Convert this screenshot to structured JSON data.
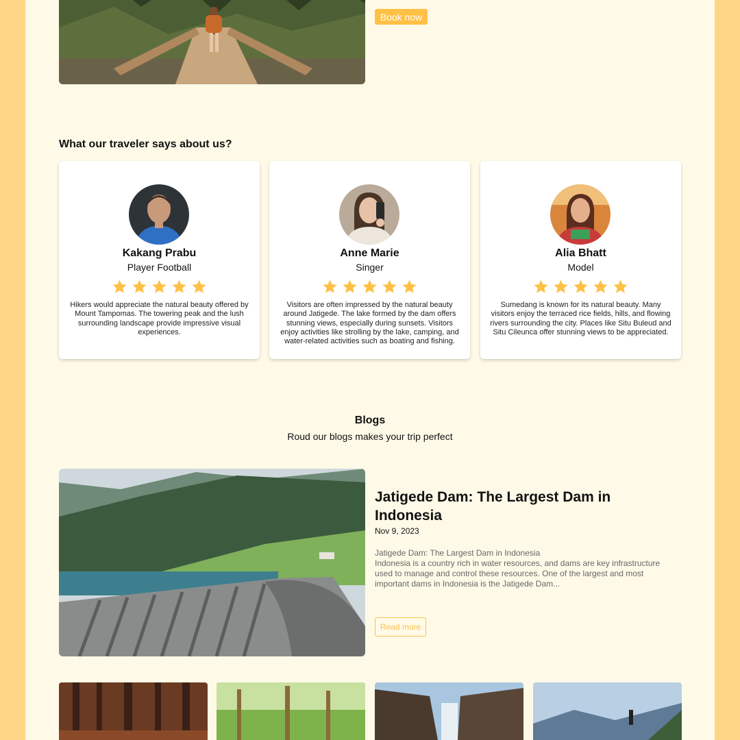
{
  "hero": {
    "book_label": "Book now"
  },
  "testimonials": {
    "title": "What our traveler says about us?",
    "items": [
      {
        "name": "Kakang Prabu",
        "role": "Player Football",
        "rating": 5,
        "text": "Hikers would appreciate the natural beauty offered by Mount Tampomas. The towering peak and the lush surrounding landscape provide impressive visual experiences."
      },
      {
        "name": "Anne Marie",
        "role": "Singer",
        "rating": 5,
        "text": "Visitors are often impressed by the natural beauty around Jatigede. The lake formed by the dam offers stunning views, especially during sunsets. Visitors enjoy activities like strolling by the lake, camping, and water-related activities such as boating and fishing."
      },
      {
        "name": "Alia Bhatt",
        "role": "Model",
        "rating": 5,
        "text": "Sumedang is known for its natural beauty. Many visitors enjoy the terraced rice fields, hills, and flowing rivers surrounding the city. Places like Situ Buleud and Situ Cileunca offer stunning views to be appreciated."
      }
    ]
  },
  "blogs": {
    "title": "Blogs",
    "subtitle": "Roud our blogs makes your trip perfect",
    "featured": {
      "title": "Jatigede Dam: The Largest Dam in Indonesia",
      "date": "Nov 9, 2023",
      "excerpt_heading": "Jatigede Dam: The Largest Dam in Indonesia",
      "excerpt": "Indonesia is a country rich in water resources, and dams are key infrastructure used to manage and control these resources. One of the largest and most important dams in Indonesia is the Jatigede Dam...",
      "read_more_label": "Read more"
    }
  },
  "colors": {
    "accent": "#fec045",
    "page_bg": "#fffae8",
    "outer_bg": "#ffd688",
    "card_bg": "#ffffff"
  }
}
